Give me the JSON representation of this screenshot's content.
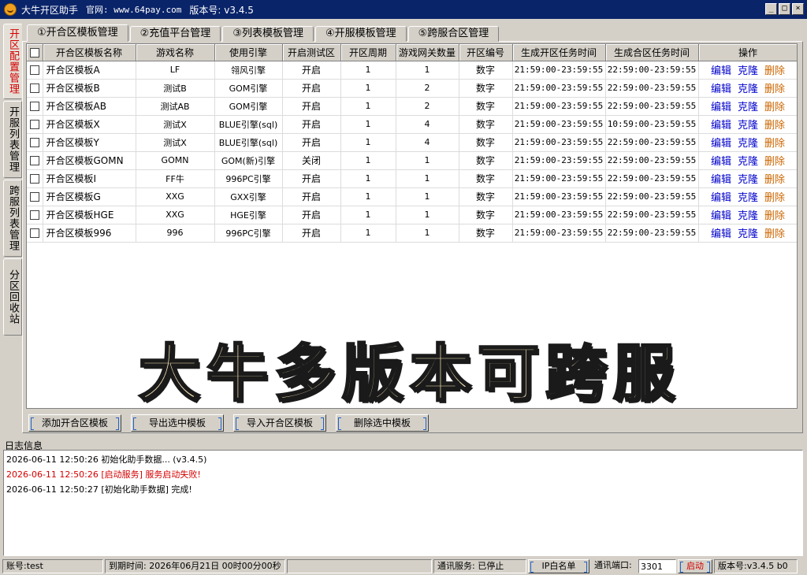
{
  "window": {
    "app_name": "大牛开区助手",
    "site": "官网: www.64pay.com",
    "version_label": "版本号: v3.4.5",
    "controls": [
      "_",
      "□",
      "×"
    ]
  },
  "side_tabs": [
    {
      "label": "开区配置管理",
      "active": true
    },
    {
      "label": "开服列表管理",
      "active": false
    },
    {
      "label": "跨服列表管理",
      "active": false
    },
    {
      "label": "分区回收站",
      "active": false
    }
  ],
  "top_tabs": [
    {
      "label": "①开合区模板管理",
      "active": true
    },
    {
      "label": "②充值平台管理",
      "active": false
    },
    {
      "label": "③列表模板管理",
      "active": false
    },
    {
      "label": "④开服模板管理",
      "active": false
    },
    {
      "label": "⑤跨服合区管理",
      "active": false
    }
  ],
  "table": {
    "columns": [
      "开合区模板名称",
      "游戏名称",
      "使用引擎",
      "开启测试区",
      "开区周期",
      "游戏网关数量",
      "开区编号",
      "生成开区任务时间",
      "生成合区任务时间",
      "操作"
    ],
    "actions": {
      "edit": "编辑",
      "clone": "克隆",
      "delete": "删除"
    },
    "rows": [
      {
        "name": "开合区模板A",
        "game": "LF",
        "engine": "翎风引擎",
        "test": "开启",
        "cycle": "1",
        "gateways": "1",
        "numbering": "数字",
        "open_time": "21:59:00-23:59:55",
        "merge_time": "22:59:00-23:59:55"
      },
      {
        "name": "开合区模板B",
        "game": "测试B",
        "engine": "GOM引擎",
        "test": "开启",
        "cycle": "1",
        "gateways": "2",
        "numbering": "数字",
        "open_time": "21:59:00-23:59:55",
        "merge_time": "22:59:00-23:59:55"
      },
      {
        "name": "开合区模板AB",
        "game": "测试AB",
        "engine": "GOM引擎",
        "test": "开启",
        "cycle": "1",
        "gateways": "2",
        "numbering": "数字",
        "open_time": "21:59:00-23:59:55",
        "merge_time": "22:59:00-23:59:55"
      },
      {
        "name": "开合区模板X",
        "game": "测试X",
        "engine": "BLUE引擎(sql)",
        "test": "开启",
        "cycle": "1",
        "gateways": "4",
        "numbering": "数字",
        "open_time": "21:59:00-23:59:55",
        "merge_time": "10:59:00-23:59:55"
      },
      {
        "name": "开合区模板Y",
        "game": "测试X",
        "engine": "BLUE引擎(sql)",
        "test": "开启",
        "cycle": "1",
        "gateways": "4",
        "numbering": "数字",
        "open_time": "21:59:00-23:59:55",
        "merge_time": "22:59:00-23:59:55"
      },
      {
        "name": "开合区模板GOMN",
        "game": "GOMN",
        "engine": "GOM(新)引擎",
        "test": "关闭",
        "cycle": "1",
        "gateways": "1",
        "numbering": "数字",
        "open_time": "21:59:00-23:59:55",
        "merge_time": "22:59:00-23:59:55"
      },
      {
        "name": "开合区模板I",
        "game": "FF牛",
        "engine": "996PC引擎",
        "test": "开启",
        "cycle": "1",
        "gateways": "1",
        "numbering": "数字",
        "open_time": "21:59:00-23:59:55",
        "merge_time": "22:59:00-23:59:55"
      },
      {
        "name": "开合区模板G",
        "game": "XXG",
        "engine": "GXX引擎",
        "test": "开启",
        "cycle": "1",
        "gateways": "1",
        "numbering": "数字",
        "open_time": "21:59:00-23:59:55",
        "merge_time": "22:59:00-23:59:55"
      },
      {
        "name": "开合区模板HGE",
        "game": "XXG",
        "engine": "HGE引擎",
        "test": "开启",
        "cycle": "1",
        "gateways": "1",
        "numbering": "数字",
        "open_time": "21:59:00-23:59:55",
        "merge_time": "22:59:00-23:59:55"
      },
      {
        "name": "开合区模板996",
        "game": "996",
        "engine": "996PC引擎",
        "test": "开启",
        "cycle": "1",
        "gateways": "1",
        "numbering": "数字",
        "open_time": "21:59:00-23:59:55",
        "merge_time": "22:59:00-23:59:55"
      }
    ]
  },
  "watermark": "大牛多版本可跨服",
  "buttons": {
    "add": "添加开合区模板",
    "export": "导出选中模板",
    "import": "导入开合区模板",
    "delete_selected": "删除选中模板"
  },
  "log": {
    "title": "日志信息",
    "entries": [
      {
        "text": "2026-06-11 12:50:26 初始化助手数据... (v3.4.5)",
        "level": "info"
      },
      {
        "text": "2026-06-11 12:50:26 [启动服务] 服务启动失败!",
        "level": "error"
      },
      {
        "text": "2026-06-11 12:50:27 [初始化助手数据] 完成!",
        "level": "info"
      }
    ]
  },
  "status": {
    "account": "账号:test",
    "expire": "到期时间: 2026年06月21日 00时00分00秒",
    "empty": "",
    "comm_service": "通讯服务: 已停止",
    "ip_whitelist": "IP白名单",
    "port_label": "通讯端口:",
    "port_value": "3301",
    "start": "启动",
    "version": "版本号:v3.4.5 b0"
  },
  "colors": {
    "titlebar": "#0a246a",
    "active_side_tab_text": "#d40000",
    "action_link": "#0000cc",
    "delete_link": "#cc6600",
    "log_error": "#d40000",
    "watermark_fill": "#f8e6b8"
  }
}
